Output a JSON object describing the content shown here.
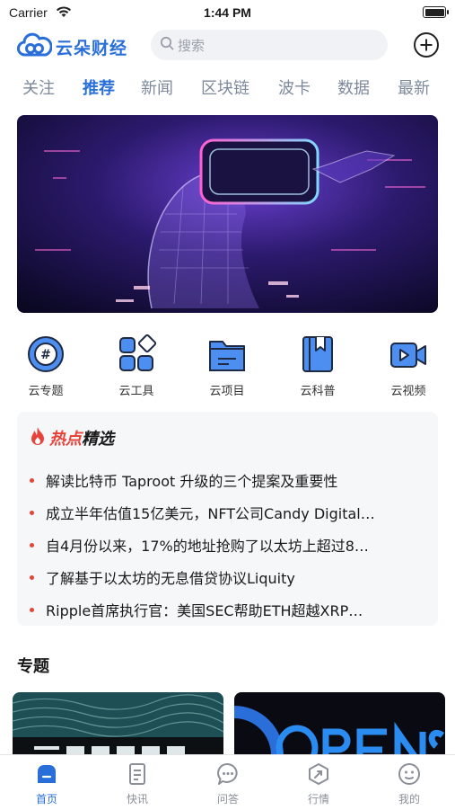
{
  "status_bar": {
    "carrier": "Carrier",
    "time": "1:44 PM"
  },
  "header": {
    "app_name": "云朵财经",
    "search_placeholder": "搜索"
  },
  "tabs": [
    {
      "label": "关注",
      "active": false
    },
    {
      "label": "推荐",
      "active": true
    },
    {
      "label": "新闻",
      "active": false
    },
    {
      "label": "区块链",
      "active": false
    },
    {
      "label": "波卡",
      "active": false
    },
    {
      "label": "数据",
      "active": false
    },
    {
      "label": "最新",
      "active": false
    }
  ],
  "quick_links": [
    {
      "label": "云专题",
      "icon": "hashtag-icon"
    },
    {
      "label": "云工具",
      "icon": "grid-shapes-icon"
    },
    {
      "label": "云项目",
      "icon": "folder-icon"
    },
    {
      "label": "云科普",
      "icon": "book-icon"
    },
    {
      "label": "云视频",
      "icon": "video-icon"
    }
  ],
  "hot": {
    "title_accent": "热点",
    "title_rest": "精选",
    "items": [
      "解读比特币 Taproot 升级的三个提案及重要性",
      "成立半年估值15亿美元，NFT公司Candy Digital…",
      "自4月份以来，17%的地址抢购了以太坊上超过8…",
      "了解基于以太坊的无息借贷协议Liquity",
      "Ripple首席执行官：美国SEC帮助ETH超越XRP…"
    ]
  },
  "topics": {
    "title": "专题"
  },
  "tabbar": [
    {
      "label": "首页",
      "icon": "home-icon",
      "active": true
    },
    {
      "label": "快讯",
      "icon": "newsflash-icon",
      "active": false
    },
    {
      "label": "问答",
      "icon": "chat-bubble-icon",
      "active": false
    },
    {
      "label": "行情",
      "icon": "market-icon",
      "active": false
    },
    {
      "label": "我的",
      "icon": "profile-icon",
      "active": false
    }
  ],
  "colors": {
    "accent": "#2a6fd9",
    "hot_red": "#e8433a",
    "tab_gray": "#7d8a9b"
  }
}
